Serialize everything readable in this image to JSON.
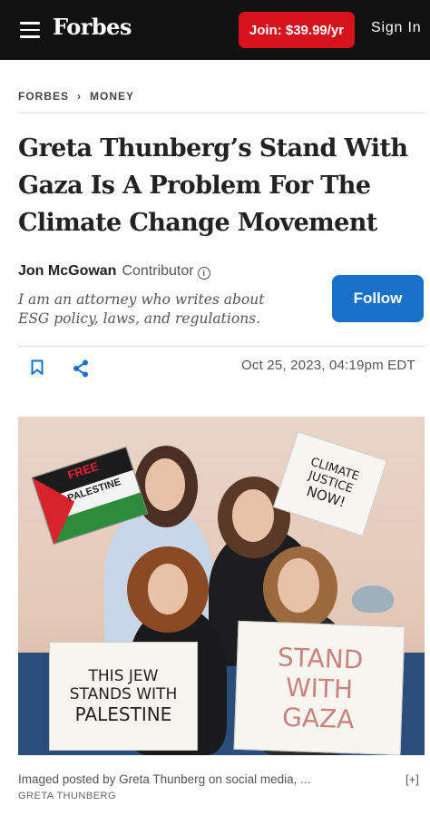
{
  "header": {
    "brand": "Forbes",
    "join_label": "Join: $39.99/yr",
    "signin_label": "Sign In",
    "accent_color": "#d6131c"
  },
  "breadcrumb": {
    "items": [
      "FORBES",
      "MONEY"
    ],
    "separator": "›"
  },
  "article": {
    "title": "Greta Thunberg’s Stand With Gaza Is A Problem For The Climate Change Movement",
    "author": {
      "name": "Jon McGowan",
      "role": "Contributor",
      "bio": "I am an attorney who writes about ESG policy, laws, and regulations."
    },
    "follow_label": "Follow",
    "follow_color": "#1970c8",
    "date": "Oct 25, 2023, 04:19pm EDT"
  },
  "photo": {
    "signs": {
      "free_palestine_1": "FREE",
      "free_palestine_2": "PALESTINE",
      "climate_1": "CLIMATE",
      "climate_2": "JUSTICE",
      "climate_3": "NOW!",
      "jew_1": "THIS JEW",
      "jew_2": "STANDS WITH",
      "jew_3": "PALESTINE",
      "gaza_1": "STAND",
      "gaza_2": "WITH",
      "gaza_3": "GAZA"
    },
    "caption": "Imaged posted by Greta Thunberg on social media, ...",
    "expand_label": "[+]",
    "credit": "GRETA THUNBERG"
  }
}
